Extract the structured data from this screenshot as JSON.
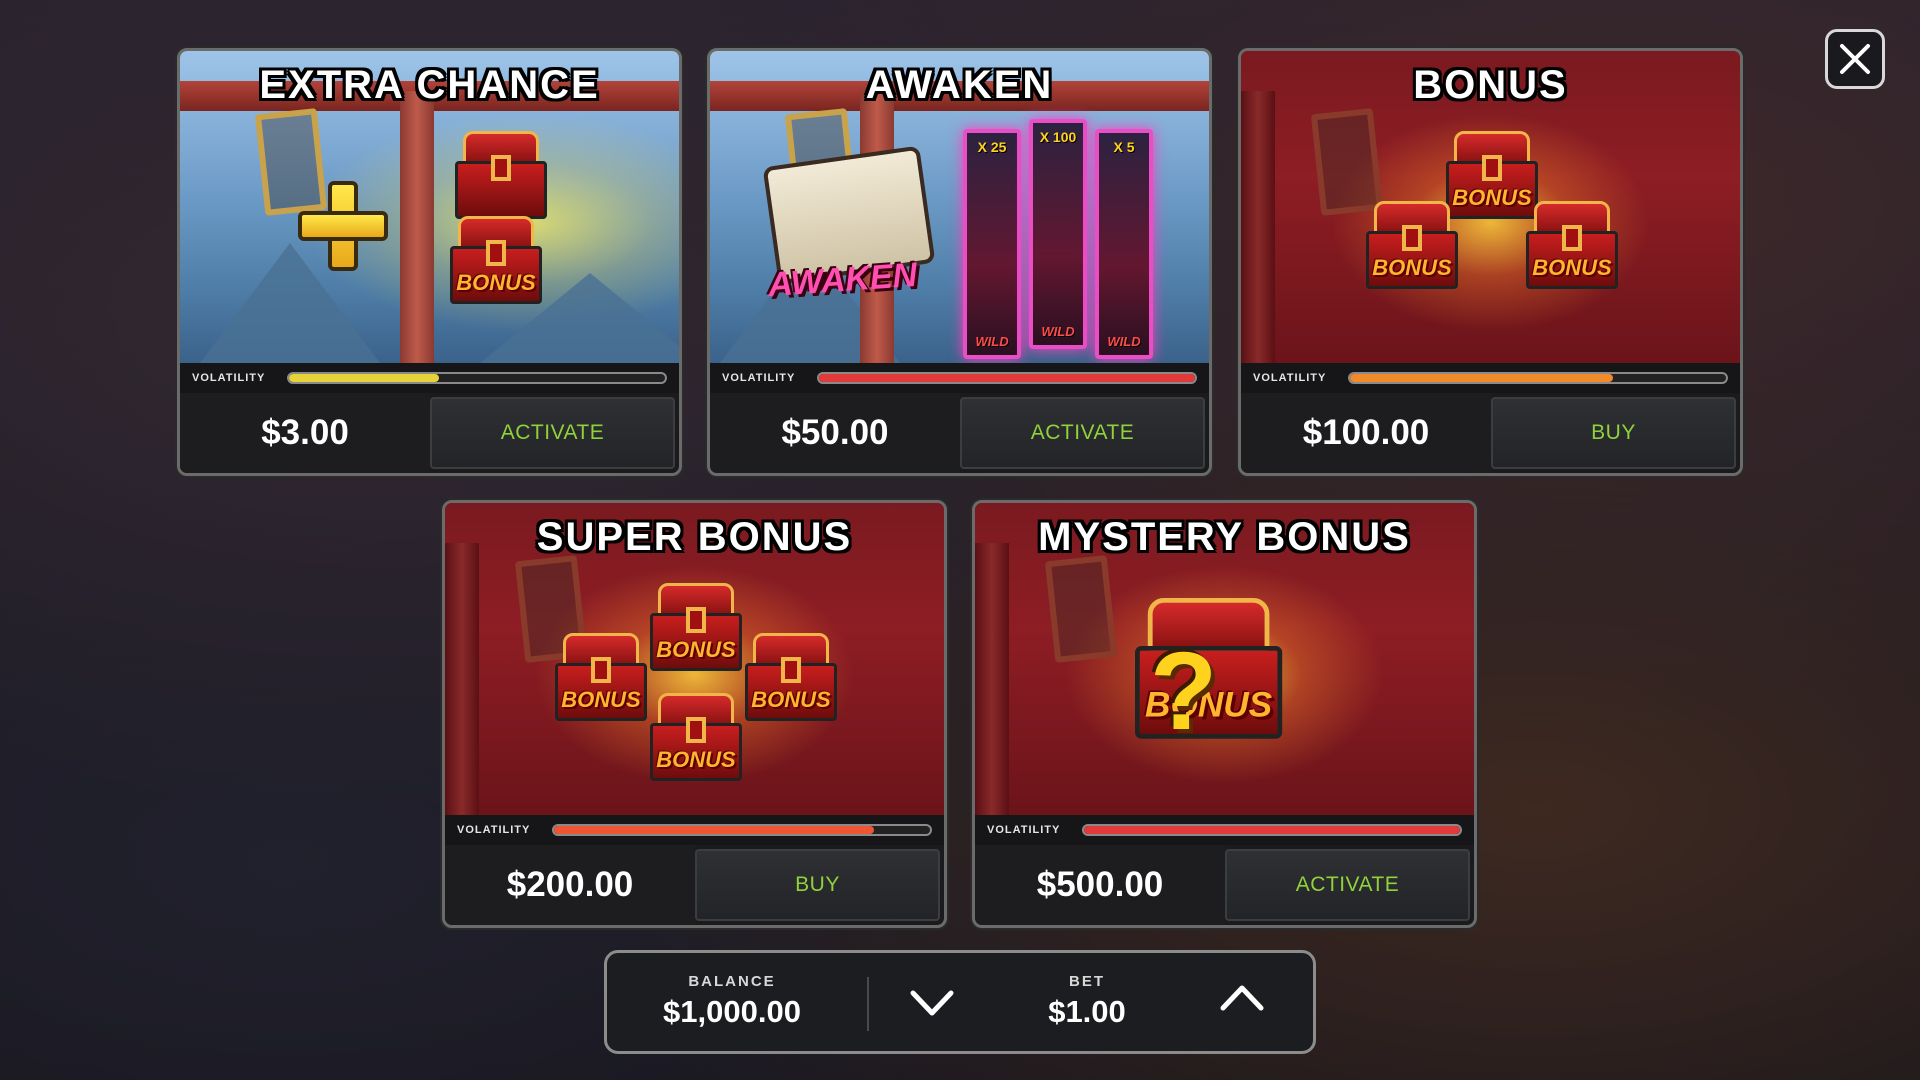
{
  "close": {
    "icon": "close-icon"
  },
  "cards": [
    {
      "title": "EXTRA CHANCE",
      "volatility_label": "VOLATILITY",
      "volatility_level": 0.4,
      "volatility_color": "#e8d23a",
      "price": "$3.00",
      "action": "ACTIVATE"
    },
    {
      "title": "AWAKEN",
      "volatility_label": "VOLATILITY",
      "volatility_level": 1.0,
      "volatility_color": "#e23a3a",
      "price": "$50.00",
      "action": "ACTIVATE",
      "art_text": "AWAKEN",
      "wilds": [
        {
          "mult": "X 25",
          "label": "WILD"
        },
        {
          "mult": "X 100",
          "label": "WILD"
        },
        {
          "mult": "X 5",
          "label": "WILD"
        }
      ]
    },
    {
      "title": "BONUS",
      "volatility_label": "VOLATILITY",
      "volatility_level": 0.7,
      "volatility_color": "#f08a2a",
      "price": "$100.00",
      "action": "BUY",
      "chest_text": "BONUS"
    },
    {
      "title": "SUPER BONUS",
      "volatility_label": "VOLATILITY",
      "volatility_level": 0.85,
      "volatility_color": "#ee5533",
      "price": "$200.00",
      "action": "BUY",
      "chest_text": "BONUS"
    },
    {
      "title": "MYSTERY BONUS",
      "volatility_label": "VOLATILITY",
      "volatility_level": 1.0,
      "volatility_color": "#e23a3a",
      "price": "$500.00",
      "action": "ACTIVATE",
      "chest_text": "BONUS",
      "mystery_mark": "?"
    }
  ],
  "footer": {
    "balance_label": "BALANCE",
    "balance_value": "$1,000.00",
    "bet_label": "BET",
    "bet_value": "$1.00",
    "decrease_icon": "chevron-down-icon",
    "increase_icon": "chevron-up-icon"
  },
  "colors": {
    "action_text": "#8fd23a",
    "panel_border": "#6b6b6b"
  }
}
